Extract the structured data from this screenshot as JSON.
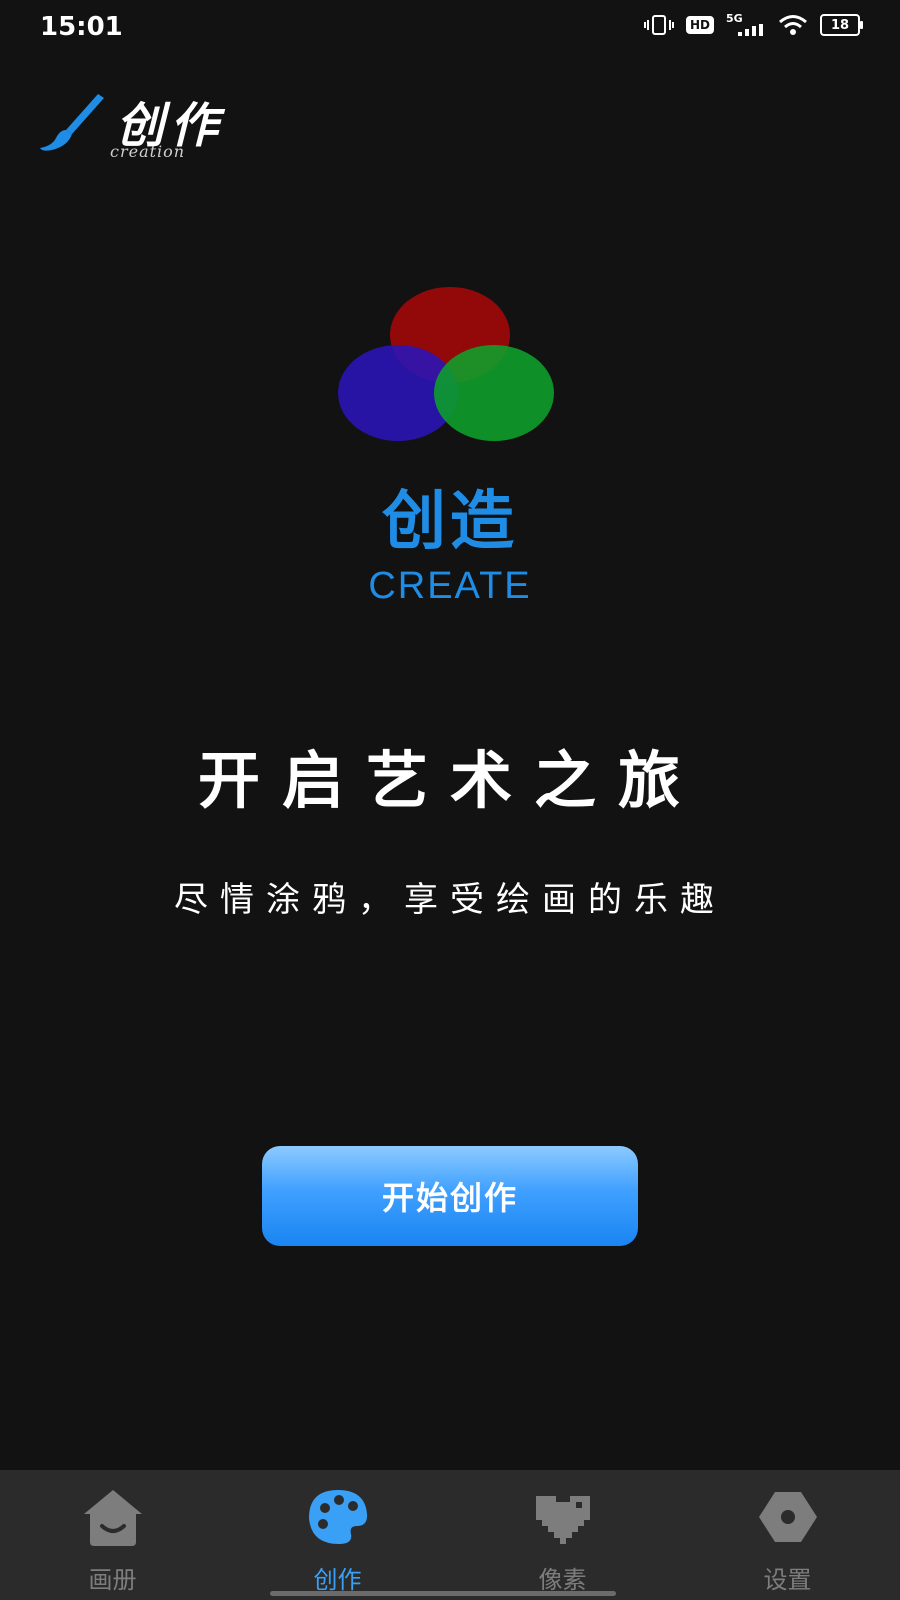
{
  "status": {
    "time": "15:01",
    "hd": "HD",
    "network": "5G",
    "battery": "18"
  },
  "header": {
    "title": "创作",
    "subtitle": "creation"
  },
  "hero": {
    "title_cn": "创造",
    "title_en": "CREATE",
    "headline": "开启艺术之旅",
    "tagline": "尽情涂鸦，享受绘画的乐趣"
  },
  "start_button": {
    "label": "开始创作"
  },
  "tabs": [
    {
      "label": "画册",
      "icon": "album-icon",
      "active": false
    },
    {
      "label": "创作",
      "icon": "palette-icon",
      "active": true
    },
    {
      "label": "像素",
      "icon": "pixel-heart-icon",
      "active": false
    },
    {
      "label": "设置",
      "icon": "settings-icon",
      "active": false
    }
  ],
  "colors": {
    "accent": "#1f8de6",
    "circle_red": "#9b0a0a",
    "circle_blue": "#2a14b8",
    "circle_green": "#0ea02a",
    "tab_inactive": "#7d7d7d",
    "tab_active": "#3aa0f5",
    "background": "#121212"
  }
}
